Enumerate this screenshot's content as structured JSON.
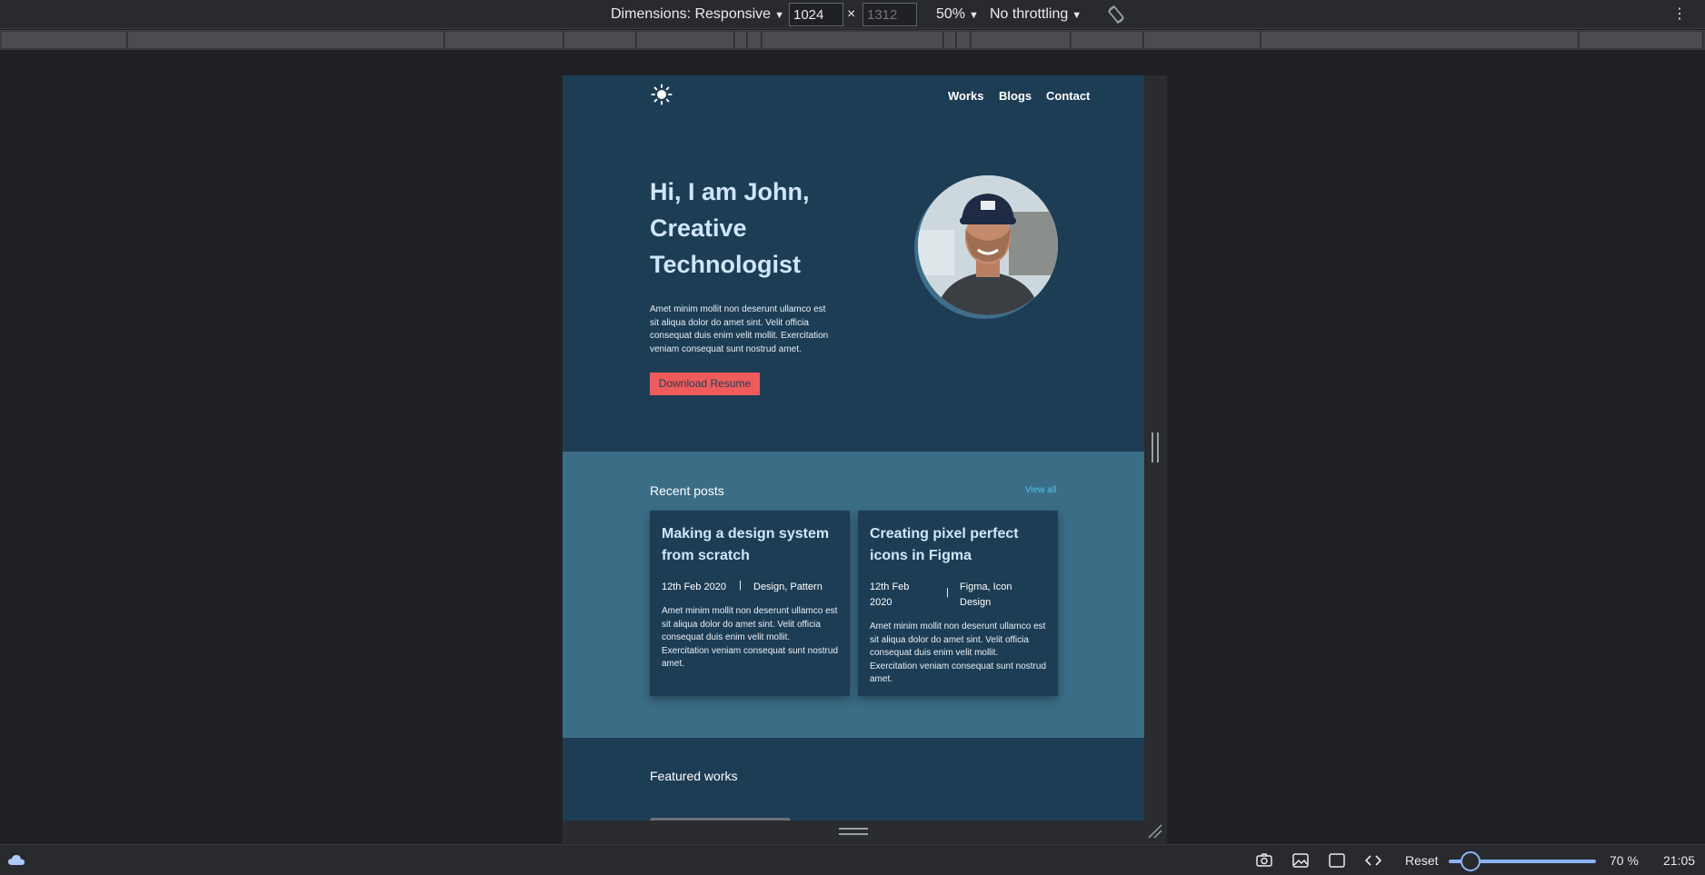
{
  "devtools": {
    "dimensions_label": "Dimensions: Responsive",
    "width_value": "1024",
    "times": "×",
    "height_placeholder": "1312",
    "zoom": "50%",
    "throttling": "No throttling"
  },
  "site": {
    "nav": {
      "logo_icon": "sun-icon",
      "links": [
        "Works",
        "Blogs",
        "Contact"
      ]
    },
    "hero": {
      "title_lines": [
        "Hi, I am John,",
        "Creative",
        "Technologist"
      ],
      "text": "Amet minim mollit non deserunt ullamco est sit aliqua dolor do amet sint. Velit officia consequat duis enim velit mollit. Exercitation veniam consequat sunt nostrud amet.",
      "button": "Download Resume"
    },
    "recent_posts": {
      "title": "Recent posts",
      "view_all": "View all",
      "posts": [
        {
          "title": "Making a design system from scratch",
          "date": "12th Feb 2020",
          "separator": "|",
          "tags": "Design, Pattern",
          "text": "Amet minim mollit non deserunt ullamco est sit aliqua dolor do amet sint. Velit officia consequat duis enim velit mollit. Exercitation veniam consequat sunt nostrud amet."
        },
        {
          "title": "Creating pixel perfect icons in Figma",
          "date": "12th Feb 2020",
          "separator": "|",
          "tags": "Figma, Icon Design",
          "text": "Amet minim mollit non deserunt ullamco est sit aliqua dolor do amet sint. Velit officia consequat duis enim velit mollit. Exercitation veniam consequat sunt nostrud amet."
        }
      ]
    },
    "featured": {
      "title": "Featured works"
    }
  },
  "status_bar": {
    "reset": "Reset",
    "zoom": "70 %",
    "clock": "21:05"
  },
  "colors": {
    "page_bg": "#1d3d55",
    "posts_bg": "#3b6d87",
    "accent_button": "#ef5b5b",
    "link_accent": "#4ec4f0",
    "heading": "#cfe6fb"
  }
}
